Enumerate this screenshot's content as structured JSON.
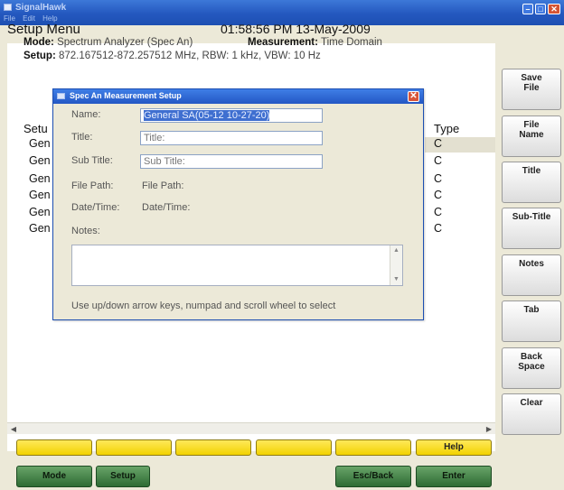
{
  "window": {
    "title": "SignalHawk",
    "menu": [
      "File",
      "Edit",
      "Help"
    ]
  },
  "header": {
    "title": "Setup Menu",
    "datetime": "01:58:56 PM 13-May-2009",
    "mode_label": "Mode:",
    "mode_value": "Spectrum Analyzer (Spec An)",
    "measurement_label": "Measurement:",
    "measurement_value": "Time Domain",
    "setup_label": "Setup:",
    "setup_value": "872.167512-872.257512 MHz, RBW: 1 kHz, VBW: 10 Hz"
  },
  "list": {
    "col_setup": "Setu",
    "col_type": "Type",
    "rows": [
      {
        "name": "Gen",
        "type": "C"
      },
      {
        "name": "Gen",
        "type": "C"
      },
      {
        "name": "Gen",
        "type": "C"
      },
      {
        "name": "Gen",
        "type": "C"
      },
      {
        "name": "Gen",
        "type": "C"
      },
      {
        "name": "Gen",
        "type": "C"
      }
    ]
  },
  "dialog": {
    "title": "Spec An Measurement Setup",
    "name_label": "Name:",
    "name_value": "General SA(05-12 10-27-20)",
    "title_label": "Title:",
    "title_value": "Title:",
    "subtitle_label": "Sub Title:",
    "subtitle_value": "Sub Title:",
    "filepath_label": "File Path:",
    "filepath_value": "File Path:",
    "datetime_label": "Date/Time:",
    "datetime_value": "Date/Time:",
    "notes_label": "Notes:",
    "hint": "Use up/down arrow keys, numpad and scroll wheel to select"
  },
  "softkeys": [
    {
      "line1": "Save",
      "line2": "File"
    },
    {
      "line1": "File",
      "line2": "Name"
    },
    {
      "line1": "Title",
      "line2": ""
    },
    {
      "line1": "Sub-Title",
      "line2": ""
    },
    {
      "line1": "Notes",
      "line2": ""
    },
    {
      "line1": "Tab",
      "line2": ""
    },
    {
      "line1": "Back",
      "line2": "Space"
    },
    {
      "line1": "Clear",
      "line2": ""
    }
  ],
  "bottom_yellow": [
    "",
    "",
    "",
    "",
    "",
    "Help"
  ],
  "bottom_green": [
    "Mode",
    "Setup",
    "Esc/Back",
    "Enter"
  ],
  "colors": {
    "titlebar": "#2458bf",
    "yellow_key": "#f2d200",
    "green_key": "#2e6b34",
    "selection": "#3f6fd0"
  }
}
